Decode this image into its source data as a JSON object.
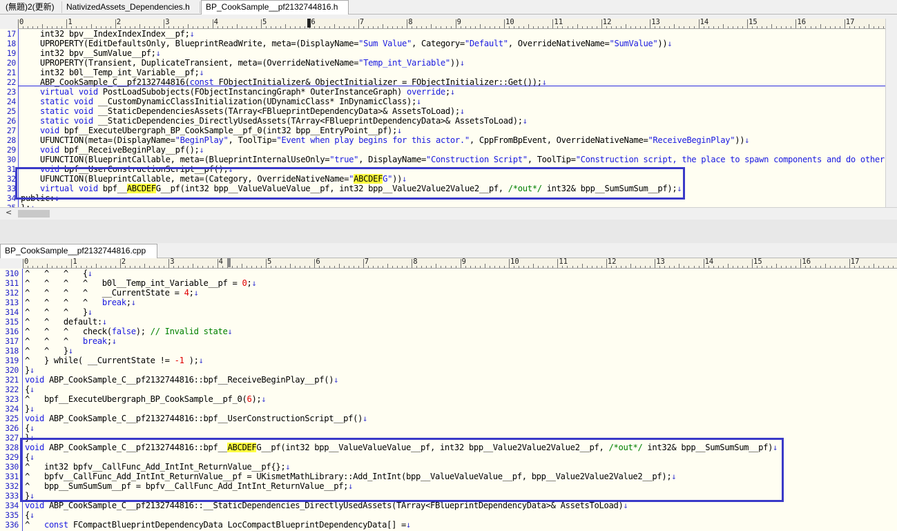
{
  "top_tabs": [
    {
      "label": "(無題)2(更新)",
      "active": false
    },
    {
      "label": "NativizedAssets_Dependencies.h",
      "active": false
    },
    {
      "label": "BP_CookSample__pf2132744816.h",
      "active": true
    }
  ],
  "bottom_tabs": [
    {
      "label": "BP_CookSample__pf2132744816.cpp",
      "active": true
    }
  ],
  "ruler_numbers": [
    "0",
    "1",
    "2",
    "3",
    "4",
    "5",
    "6",
    "7",
    "8",
    "9",
    "10",
    "11",
    "12",
    "13",
    "14",
    "15",
    "16",
    "17"
  ],
  "top_editor": {
    "lines": [
      {
        "n": "17",
        "segs": [
          [
            "t",
            "    int32 bpv__IndexIndexIndex__pf;"
          ]
        ]
      },
      {
        "n": "18",
        "segs": [
          [
            "t",
            "    UPROPERTY(EditDefaultsOnly, BlueprintReadWrite, meta=(DisplayName="
          ],
          [
            "s",
            "\"Sum Value\""
          ],
          [
            "t",
            ", Category="
          ],
          [
            "s",
            "\"Default\""
          ],
          [
            "t",
            ", OverrideNativeName="
          ],
          [
            "s",
            "\"SumValue\""
          ],
          [
            "t",
            "))"
          ]
        ]
      },
      {
        "n": "19",
        "segs": [
          [
            "t",
            "    int32 bpv__SumValue__pf;"
          ]
        ]
      },
      {
        "n": "20",
        "segs": [
          [
            "t",
            "    UPROPERTY(Transient, DuplicateTransient, meta=(OverrideNativeName="
          ],
          [
            "s",
            "\"Temp_int_Variable\""
          ],
          [
            "t",
            "))"
          ]
        ]
      },
      {
        "n": "21",
        "segs": [
          [
            "t",
            "    int32 b0l__Temp_int_Variable__pf;"
          ]
        ]
      },
      {
        "n": "22",
        "segs": [
          [
            "t",
            "    ABP_CookSample_C__pf2132744816("
          ],
          [
            "k",
            "const"
          ],
          [
            "t",
            " FObjectInitializer& ObjectInitializer = FObjectInitializer::Get());"
          ]
        ]
      },
      {
        "n": "23",
        "segs": [
          [
            "t",
            "    "
          ],
          [
            "k",
            "virtual void"
          ],
          [
            "t",
            " PostLoadSubobjects(FObjectInstancingGraph* OuterInstanceGraph) "
          ],
          [
            "k",
            "override"
          ],
          [
            "t",
            ";"
          ]
        ]
      },
      {
        "n": "24",
        "segs": [
          [
            "t",
            "    "
          ],
          [
            "k",
            "static void"
          ],
          [
            "t",
            " __CustomDynamicClassInitialization(UDynamicClass* InDynamicClass);"
          ]
        ]
      },
      {
        "n": "25",
        "segs": [
          [
            "t",
            "    "
          ],
          [
            "k",
            "static void"
          ],
          [
            "t",
            " __StaticDependenciesAssets(TArray<FBlueprintDependencyData>& AssetsToLoad);"
          ]
        ]
      },
      {
        "n": "26",
        "segs": [
          [
            "t",
            "    "
          ],
          [
            "k",
            "static void"
          ],
          [
            "t",
            " __StaticDependencies_DirectlyUsedAssets(TArray<FBlueprintDependencyData>& AssetsToLoad);"
          ]
        ]
      },
      {
        "n": "27",
        "segs": [
          [
            "t",
            "    "
          ],
          [
            "k",
            "void"
          ],
          [
            "t",
            " bpf__ExecuteUbergraph_BP_CookSample__pf_0(int32 bpp__EntryPoint__pf);"
          ]
        ]
      },
      {
        "n": "28",
        "segs": [
          [
            "t",
            "    UFUNCTION(meta=(DisplayName="
          ],
          [
            "s",
            "\"BeginPlay\""
          ],
          [
            "t",
            ", ToolTip="
          ],
          [
            "s",
            "\"Event when play begins for this actor.\""
          ],
          [
            "t",
            ", CppFromBpEvent, OverrideNativeName="
          ],
          [
            "s",
            "\"ReceiveBeginPlay\""
          ],
          [
            "t",
            "))"
          ]
        ]
      },
      {
        "n": "29",
        "segs": [
          [
            "t",
            "    "
          ],
          [
            "k",
            "void"
          ],
          [
            "t",
            " bpf__ReceiveBeginPlay__pf();"
          ]
        ]
      },
      {
        "n": "30",
        "segs": [
          [
            "t",
            "    UFUNCTION(BlueprintCallable, meta=(BlueprintInternalUseOnly="
          ],
          [
            "s",
            "\"true\""
          ],
          [
            "t",
            ", DisplayName="
          ],
          [
            "s",
            "\"Construction Script\""
          ],
          [
            "t",
            ", ToolTip="
          ],
          [
            "s",
            "\"Construction script, the place to spawn components and do other se"
          ]
        ]
      },
      {
        "n": "31",
        "segs": [
          [
            "t",
            "    "
          ],
          [
            "k",
            "void"
          ],
          [
            "t",
            " bpf__UserConstructionScript__pf();"
          ]
        ]
      },
      {
        "n": "32",
        "segs": [
          [
            "t",
            "    UFUNCTION(BlueprintCallable, meta=(Category, OverrideNativeName="
          ],
          [
            "s",
            "\""
          ],
          [
            "h",
            "ABCDEF"
          ],
          [
            "s",
            "G\""
          ],
          [
            "t",
            "))"
          ]
        ]
      },
      {
        "n": "33",
        "segs": [
          [
            "t",
            "    "
          ],
          [
            "k",
            "virtual void"
          ],
          [
            "t",
            " bpf__"
          ],
          [
            "h",
            "ABCDEF"
          ],
          [
            "t",
            "G__pf(int32 bpp__ValueValueValue__pf, int32 bpp__Value2Value2Value2__pf, "
          ],
          [
            "c",
            "/*out*/"
          ],
          [
            "t",
            " int32& bpp__SumSumSum__pf);"
          ]
        ]
      },
      {
        "n": "34",
        "segs": [
          [
            "t",
            "public:"
          ]
        ]
      },
      {
        "n": "35",
        "segs": [
          [
            "t",
            "};"
          ]
        ]
      }
    ]
  },
  "bottom_editor": {
    "lines": [
      {
        "n": "310",
        "segs": [
          [
            "t",
            "^   ^   ^   {"
          ]
        ]
      },
      {
        "n": "311",
        "segs": [
          [
            "t",
            "^   ^   ^   ^   b0l__Temp_int_Variable__pf = "
          ],
          [
            "r",
            "0"
          ],
          [
            "t",
            ";"
          ]
        ]
      },
      {
        "n": "312",
        "segs": [
          [
            "t",
            "^   ^   ^   ^   __CurrentState = "
          ],
          [
            "r",
            "4"
          ],
          [
            "t",
            ";"
          ]
        ]
      },
      {
        "n": "313",
        "segs": [
          [
            "t",
            "^   ^   ^   ^   "
          ],
          [
            "k",
            "break"
          ],
          [
            "t",
            ";"
          ]
        ]
      },
      {
        "n": "314",
        "segs": [
          [
            "t",
            "^   ^   ^   }"
          ]
        ]
      },
      {
        "n": "315",
        "segs": [
          [
            "t",
            "^   ^   default:"
          ]
        ]
      },
      {
        "n": "316",
        "segs": [
          [
            "t",
            "^   ^   ^   check("
          ],
          [
            "k",
            "false"
          ],
          [
            "t",
            "); "
          ],
          [
            "c",
            "// Invalid state"
          ]
        ]
      },
      {
        "n": "317",
        "segs": [
          [
            "t",
            "^   ^   ^   "
          ],
          [
            "k",
            "break"
          ],
          [
            "t",
            ";"
          ]
        ]
      },
      {
        "n": "318",
        "segs": [
          [
            "t",
            "^   ^   }"
          ]
        ]
      },
      {
        "n": "319",
        "segs": [
          [
            "t",
            "^   } while( __CurrentState != "
          ],
          [
            "r",
            "-1"
          ],
          [
            "t",
            " );"
          ]
        ]
      },
      {
        "n": "320",
        "segs": [
          [
            "t",
            "}"
          ]
        ]
      },
      {
        "n": "321",
        "segs": [
          [
            "k",
            "void"
          ],
          [
            "t",
            " ABP_CookSample_C__pf2132744816::bpf__ReceiveBeginPlay__pf()"
          ]
        ]
      },
      {
        "n": "322",
        "segs": [
          [
            "t",
            "{"
          ]
        ]
      },
      {
        "n": "323",
        "segs": [
          [
            "t",
            "^   bpf__ExecuteUbergraph_BP_CookSample__pf_0("
          ],
          [
            "r",
            "6"
          ],
          [
            "t",
            ");"
          ]
        ]
      },
      {
        "n": "324",
        "segs": [
          [
            "t",
            "}"
          ]
        ]
      },
      {
        "n": "325",
        "segs": [
          [
            "k",
            "void"
          ],
          [
            "t",
            " ABP_CookSample_C__pf2132744816::bpf__UserConstructionScript__pf()"
          ]
        ]
      },
      {
        "n": "326",
        "segs": [
          [
            "t",
            "{"
          ]
        ]
      },
      {
        "n": "327",
        "segs": [
          [
            "t",
            "}"
          ]
        ]
      },
      {
        "n": "328",
        "segs": [
          [
            "k",
            "void"
          ],
          [
            "t",
            " ABP_CookSample_C__pf2132744816::bpf__"
          ],
          [
            "h",
            "ABCDEF"
          ],
          [
            "t",
            "G__pf(int32 bpp__ValueValueValue__pf, int32 bpp__Value2Value2Value2__pf, "
          ],
          [
            "c",
            "/*out*/"
          ],
          [
            "t",
            " int32& bpp__SumSumSum__pf)"
          ]
        ]
      },
      {
        "n": "329",
        "segs": [
          [
            "t",
            "{"
          ]
        ]
      },
      {
        "n": "330",
        "segs": [
          [
            "t",
            "^   int32 bpfv__CallFunc_Add_IntInt_ReturnValue__pf{};"
          ]
        ]
      },
      {
        "n": "331",
        "segs": [
          [
            "t",
            "^   bpfv__CallFunc_Add_IntInt_ReturnValue__pf = UKismetMathLibrary::Add_IntInt(bpp__ValueValueValue__pf, bpp__Value2Value2Value2__pf);"
          ]
        ]
      },
      {
        "n": "332",
        "segs": [
          [
            "t",
            "^   bpp__SumSumSum__pf = bpfv__CallFunc_Add_IntInt_ReturnValue__pf;"
          ]
        ]
      },
      {
        "n": "333",
        "segs": [
          [
            "t",
            "}"
          ]
        ]
      },
      {
        "n": "334",
        "segs": [
          [
            "k",
            "void"
          ],
          [
            "t",
            " ABP_CookSample_C__pf2132744816::__StaticDependencies_DirectlyUsedAssets(TArray<FBlueprintDependencyData>& AssetsToLoad)"
          ]
        ]
      },
      {
        "n": "335",
        "segs": [
          [
            "t",
            "{"
          ]
        ]
      },
      {
        "n": "336",
        "segs": [
          [
            "t",
            "^   "
          ],
          [
            "k",
            "const"
          ],
          [
            "t",
            " FCompactBlueprintDependencyData LocCompactBlueprintDependencyData[] ="
          ]
        ]
      }
    ]
  },
  "colors": {
    "highlight": "#ffff40",
    "keyword": "#1a1ae0",
    "box": "#3a3ac8",
    "comment": "#008000",
    "number": "#e00000"
  },
  "newline_glyph": "↓",
  "scroll_left_arrow": "<"
}
